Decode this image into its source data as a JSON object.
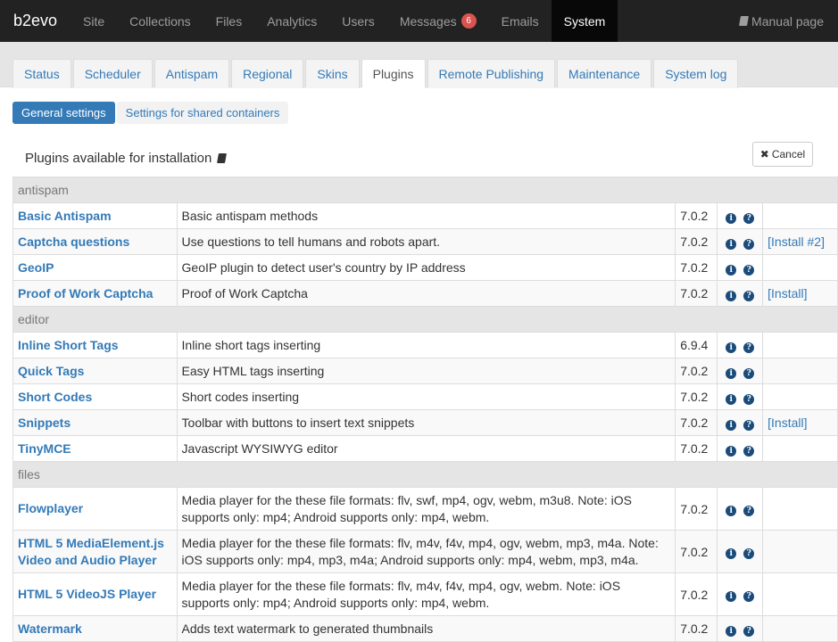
{
  "topnav": {
    "brand": "b2evo",
    "items": [
      {
        "label": "Site"
      },
      {
        "label": "Collections"
      },
      {
        "label": "Files"
      },
      {
        "label": "Analytics"
      },
      {
        "label": "Users"
      },
      {
        "label": "Messages",
        "badge": "6"
      },
      {
        "label": "Emails"
      },
      {
        "label": "System",
        "active": true
      }
    ],
    "manual": "Manual page"
  },
  "tabs": [
    {
      "label": "Status"
    },
    {
      "label": "Scheduler"
    },
    {
      "label": "Antispam"
    },
    {
      "label": "Regional"
    },
    {
      "label": "Skins"
    },
    {
      "label": "Plugins",
      "active": true
    },
    {
      "label": "Remote Publishing"
    },
    {
      "label": "Maintenance"
    },
    {
      "label": "System log"
    }
  ],
  "subtabs": [
    {
      "label": "General settings",
      "active": true
    },
    {
      "label": "Settings for shared containers"
    }
  ],
  "panel": {
    "title": "Plugins available for installation",
    "cancel": "Cancel"
  },
  "table": {
    "groups": [
      {
        "name": "antispam",
        "plugins": [
          {
            "name": "Basic Antispam",
            "desc": "Basic antispam methods",
            "version": "7.0.2",
            "action": ""
          },
          {
            "name": "Captcha questions",
            "desc": "Use questions to tell humans and robots apart.",
            "version": "7.0.2",
            "action": "[Install #2]"
          },
          {
            "name": "GeoIP",
            "desc": "GeoIP plugin to detect user's country by IP address",
            "version": "7.0.2",
            "action": ""
          },
          {
            "name": "Proof of Work Captcha",
            "desc": "Proof of Work Captcha",
            "version": "7.0.2",
            "action": "[Install]"
          }
        ]
      },
      {
        "name": "editor",
        "plugins": [
          {
            "name": "Inline Short Tags",
            "desc": "Inline short tags inserting",
            "version": "6.9.4",
            "action": ""
          },
          {
            "name": "Quick Tags",
            "desc": "Easy HTML tags inserting",
            "version": "7.0.2",
            "action": ""
          },
          {
            "name": "Short Codes",
            "desc": "Short codes inserting",
            "version": "7.0.2",
            "action": ""
          },
          {
            "name": "Snippets",
            "desc": "Toolbar with buttons to insert text snippets",
            "version": "7.0.2",
            "action": "[Install]"
          },
          {
            "name": "TinyMCE",
            "desc": "Javascript WYSIWYG editor",
            "version": "7.0.2",
            "action": ""
          }
        ]
      },
      {
        "name": "files",
        "plugins": [
          {
            "name": "Flowplayer",
            "desc": "Media player for the these file formats: flv, swf, mp4, ogv, webm, m3u8. Note: iOS supports only: mp4; Android supports only: mp4, webm.",
            "version": "7.0.2",
            "action": "",
            "tall": true
          },
          {
            "name": "HTML 5 MediaElement.js Video and Audio Player",
            "desc": "Media player for the these file formats: flv, m4v, f4v, mp4, ogv, webm, mp3, m4a. Note: iOS supports only: mp4, mp3, m4a; Android supports only: mp4, webm, mp3, m4a.",
            "version": "7.0.2",
            "action": "",
            "tall": true
          },
          {
            "name": "HTML 5 VideoJS Player",
            "desc": "Media player for the these file formats: flv, m4v, f4v, mp4, ogv, webm. Note: iOS supports only: mp4; Android supports only: mp4, webm.",
            "version": "7.0.2",
            "action": "",
            "tall": true
          },
          {
            "name": "Watermark",
            "desc": "Adds text watermark to generated thumbnails",
            "version": "7.0.2",
            "action": ""
          }
        ]
      }
    ]
  }
}
